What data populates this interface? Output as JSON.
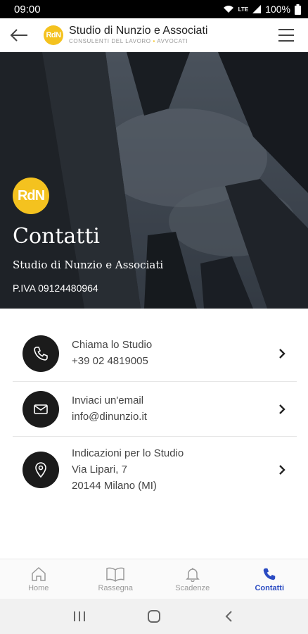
{
  "status_bar": {
    "time": "09:00",
    "network": "LTE",
    "battery": "100%"
  },
  "header": {
    "logo_text": "RdN",
    "title": "Studio di Nunzio e Associati",
    "subtitle_left": "CONSULENTI DEL LAVORO",
    "subtitle_sep": "•",
    "subtitle_right": "AVVOCATI"
  },
  "hero": {
    "logo_text": "RdN",
    "title": "Contatti",
    "subtitle": "Studio di Nunzio e Associati",
    "vat": "P.IVA 09124480964"
  },
  "contacts": [
    {
      "title": "Chiama lo Studio",
      "line1": "+39 02 4819005",
      "icon": "phone-icon"
    },
    {
      "title": "Inviaci un'email",
      "line1": "info@dinunzio.it",
      "icon": "mail-icon"
    },
    {
      "title": "Indicazioni per lo Studio",
      "line1": "Via Lipari, 7",
      "line2": "20144 Milano (MI)",
      "icon": "location-pin-icon"
    }
  ],
  "bottom_nav": [
    {
      "label": "Home",
      "icon": "home-icon",
      "active": false
    },
    {
      "label": "Rassegna",
      "icon": "book-icon",
      "active": false
    },
    {
      "label": "Scadenze",
      "icon": "bell-icon",
      "active": false
    },
    {
      "label": "Contatti",
      "icon": "phone-icon",
      "active": true
    }
  ],
  "colors": {
    "accent": "#f4c21f",
    "active_nav": "#2a4bc2",
    "icon_bg": "#1b1b1b"
  }
}
